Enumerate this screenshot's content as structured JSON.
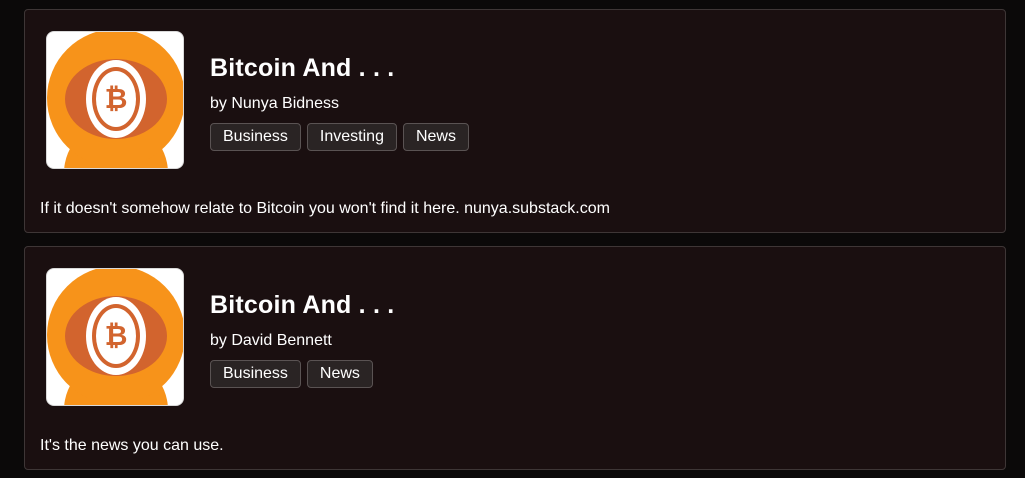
{
  "colors": {
    "page_background": "#0b0909",
    "card_background": "#1a0f10",
    "card_border": "#3e3636",
    "tag_background": "#2a2424",
    "tag_border": "#5a5353",
    "text": "#ffffff",
    "logo_orange": "#f7931a",
    "logo_dark_orange": "#d2642e"
  },
  "podcasts": [
    {
      "thumbnail_icon": "bitcoin-icon",
      "title": "Bitcoin And . . .",
      "author": "by Nunya Bidness",
      "tags": [
        "Business",
        "Investing",
        "News"
      ],
      "description": "If it doesn't somehow relate to Bitcoin you won't find it here. nunya.substack.com"
    },
    {
      "thumbnail_icon": "bitcoin-icon",
      "title": "Bitcoin And . . .",
      "author": "by David Bennett",
      "tags": [
        "Business",
        "News"
      ],
      "description": "It's the news you can use."
    }
  ]
}
